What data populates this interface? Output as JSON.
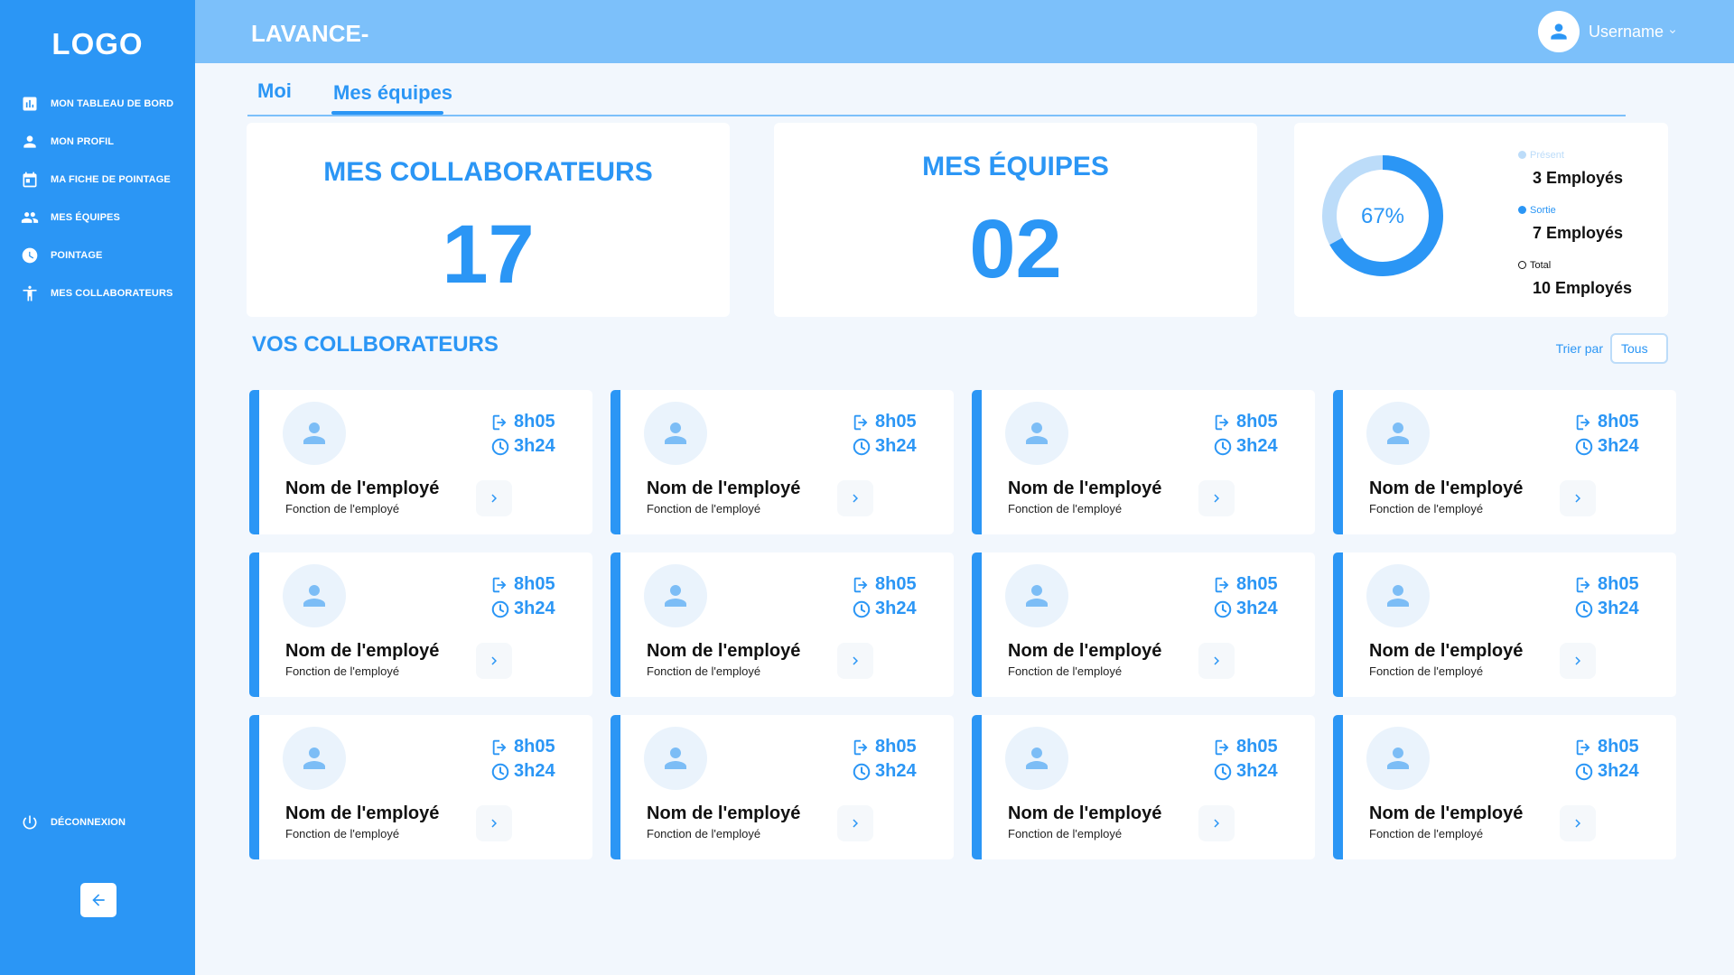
{
  "sidebar": {
    "logo": "LOGO",
    "items": [
      {
        "label": "MON TABLEAU DE BORD",
        "icon": "bar-chart-icon"
      },
      {
        "label": "MON PROFIL",
        "icon": "person-icon"
      },
      {
        "label": "MA FICHE DE POINTAGE",
        "icon": "calendar-icon"
      },
      {
        "label": "MES ÉQUIPES",
        "icon": "people-icon"
      },
      {
        "label": "POINTAGE",
        "icon": "clock-icon"
      },
      {
        "label": "MES COLLABORATEURS",
        "icon": "accessibility-icon"
      }
    ],
    "logout_label": "DÉCONNEXION"
  },
  "header": {
    "title": "LAVANCE-",
    "username": "Username"
  },
  "tabs": [
    {
      "label": "Moi",
      "active": false
    },
    {
      "label": "Mes équipes",
      "active": true
    }
  ],
  "stats": {
    "collaborateurs": {
      "title": "MES COLLABORATEURS",
      "value": "17"
    },
    "equipes": {
      "title": "MES ÉQUIPES",
      "value": "02"
    },
    "presence": {
      "percent_label": "67%",
      "fraction": 0.67,
      "legend": [
        {
          "label": "Présent",
          "value": "3 Employés",
          "color": "#bcdcf9"
        },
        {
          "label": "Sortie",
          "value": "7 Employés",
          "color": "#2b96f5"
        },
        {
          "label": "Total",
          "value": "10 Employés",
          "color": "#ffffff"
        }
      ]
    }
  },
  "section": {
    "title": "VOS COLLBORATEURS",
    "sort_label": "Trier par",
    "sort_value": "Tous"
  },
  "employees": [
    {
      "name": "Nom de l'employé",
      "function": "Fonction de l'employé",
      "arrival": "8h05",
      "duration": "3h24"
    },
    {
      "name": "Nom de l'employé",
      "function": "Fonction de l'employé",
      "arrival": "8h05",
      "duration": "3h24"
    },
    {
      "name": "Nom de l'employé",
      "function": "Fonction de l'employé",
      "arrival": "8h05",
      "duration": "3h24"
    },
    {
      "name": "Nom de l'employé",
      "function": "Fonction de l'employé",
      "arrival": "8h05",
      "duration": "3h24"
    },
    {
      "name": "Nom de l'employé",
      "function": "Fonction de l'employé",
      "arrival": "8h05",
      "duration": "3h24"
    },
    {
      "name": "Nom de l'employé",
      "function": "Fonction de l'employé",
      "arrival": "8h05",
      "duration": "3h24"
    },
    {
      "name": "Nom de l'employé",
      "function": "Fonction de l'employé",
      "arrival": "8h05",
      "duration": "3h24"
    },
    {
      "name": "Nom de l'employé",
      "function": "Fonction de l'employé",
      "arrival": "8h05",
      "duration": "3h24"
    },
    {
      "name": "Nom de l'employé",
      "function": "Fonction de l'employé",
      "arrival": "8h05",
      "duration": "3h24"
    },
    {
      "name": "Nom de l'employé",
      "function": "Fonction de l'employé",
      "arrival": "8h05",
      "duration": "3h24"
    },
    {
      "name": "Nom de l'employé",
      "function": "Fonction de l'employé",
      "arrival": "8h05",
      "duration": "3h24"
    },
    {
      "name": "Nom de l'employé",
      "function": "Fonction de l'employé",
      "arrival": "8h05",
      "duration": "3h24"
    }
  ],
  "colors": {
    "primary": "#2b96f5",
    "header": "#7cc0fa",
    "background": "#f2f7fd"
  }
}
